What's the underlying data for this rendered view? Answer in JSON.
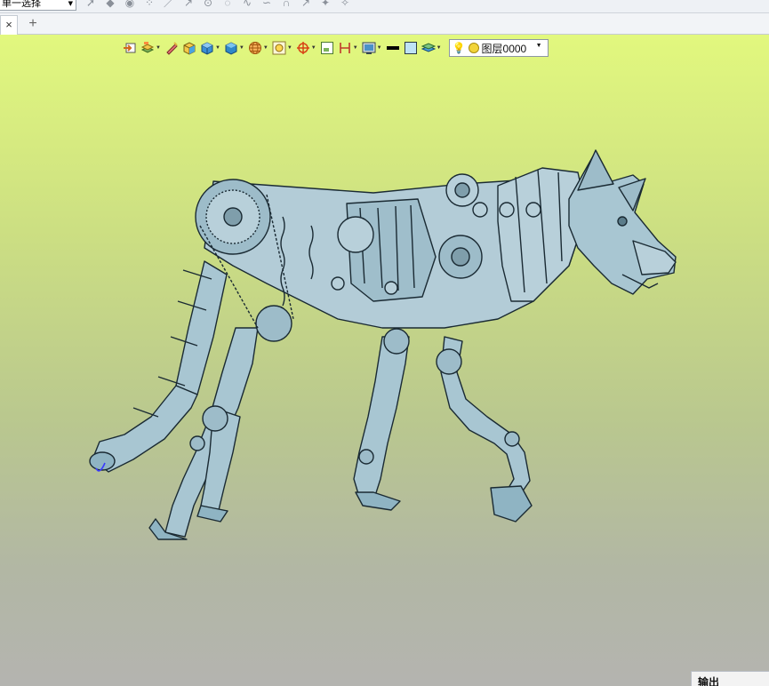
{
  "topbar": {
    "filter_value": "单一选择",
    "icons": [
      "pointer-icon",
      "solid-icon",
      "play-icon",
      "point-icon",
      "line-icon",
      "line-point-icon",
      "circle-point-icon",
      "arc-icon",
      "spline-icon",
      "curve-icon",
      "arch-icon",
      "sketch-icon",
      "shape-a-icon",
      "shape-b-icon"
    ]
  },
  "tabs": {
    "close_glyph": "×",
    "add_glyph": "+"
  },
  "view_toolbar": {
    "buttons": [
      "view-orient-icon",
      "layer-display-icon",
      "edit-icon",
      "shaded-box-icon",
      "shaded-cube-icon",
      "display-mode-icon",
      "wireframe-sphere-icon",
      "zoom-fit-icon",
      "view-center-icon",
      "frame-icon",
      "dimension-icon",
      "screen-capture-icon",
      "color-black-icon",
      "color-lightblue-icon",
      "layer-stack-icon"
    ],
    "layer_value": "图层0000"
  },
  "output_panel": {
    "title": "输出"
  },
  "colors": {
    "model_fill": "#a8c6d2",
    "model_edge": "#1a2a33",
    "selection_highlight": "#3a3aff",
    "viewport_top": "#e2f87e",
    "viewport_bottom": "#b4b4b0"
  }
}
